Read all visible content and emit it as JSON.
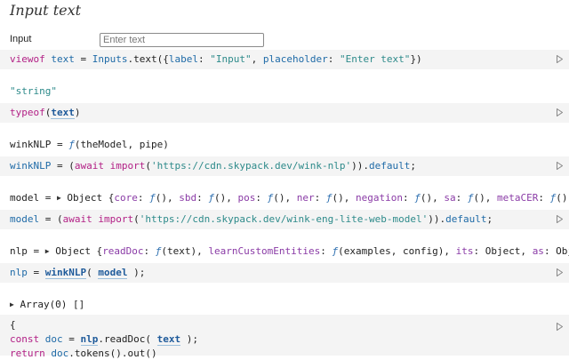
{
  "heading": "Input text",
  "input": {
    "label": "Input",
    "placeholder": "Enter text",
    "value": ""
  },
  "cells": {
    "c1": {
      "t1": "viewof",
      "t2": " text",
      "t3": " = ",
      "t4": "Inputs",
      "t5": ".text({",
      "t6": "label",
      "t7": ": ",
      "t8": "\"Input\"",
      "t9": ", ",
      "t10": "placeholder",
      "t11": ": ",
      "t12": "\"Enter text\"",
      "t13": "})"
    },
    "o2": "\"string\"",
    "c2": {
      "t1": "typeof",
      "t2": "(",
      "t3": "text",
      "t4": ")"
    },
    "o3": {
      "t1": "winkNLP = ",
      "t2": "ƒ",
      "t3": "(theModel, pipe)"
    },
    "c3": {
      "t1": "winkNLP",
      "t2": " = (",
      "t3": "await",
      "t4": " ",
      "t5": "import",
      "t6": "(",
      "t7": "'https://cdn.skypack.dev/wink-nlp'",
      "t8": ")).",
      "t9": "default",
      "t10": ";"
    },
    "o4": {
      "t1": "model = ",
      "t2": "▶",
      "t3": " Object {",
      "k1": "core",
      "v1": ": ",
      "f1": "ƒ",
      "p1": "(), ",
      "k2": "sbd",
      "v2": ": ",
      "f2": "ƒ",
      "p2": "(), ",
      "k3": "pos",
      "v3": ": ",
      "f3": "ƒ",
      "p3": "(), ",
      "k4": "ner",
      "v4": ": ",
      "f4": "ƒ",
      "p4": "(), ",
      "k5": "negation",
      "v5": ": ",
      "f5": "ƒ",
      "p5": "(), ",
      "k6": "sa",
      "v6": ": ",
      "f6": "ƒ",
      "p6": "(), ",
      "k7": "metaCER",
      "v7": ": ",
      "f7": "ƒ",
      "p7": "(),"
    },
    "c4": {
      "t1": "model",
      "t2": " = (",
      "t3": "await",
      "t4": " ",
      "t5": "import",
      "t6": "(",
      "t7": "'https://cdn.skypack.dev/wink-eng-lite-web-model'",
      "t8": ")).",
      "t9": "default",
      "t10": ";"
    },
    "o5": {
      "t1": "nlp = ",
      "t2": "▶",
      "t3": " Object {",
      "k1": "readDoc",
      "v1": ": ",
      "f1": "ƒ",
      "p1": "(text), ",
      "k2": "learnCustomEntities",
      "v2": ": ",
      "f2": "ƒ",
      "p2": "(examples, config), ",
      "k3": "its",
      "v3": ": Object, ",
      "k4": "as",
      "v4": ": Obje"
    },
    "c5": {
      "t1": "nlp",
      "t2": " = ",
      "t3": "winkNLP",
      "t4": "( ",
      "t5": "model",
      "t6": " );"
    },
    "o6": {
      "t1": "▶",
      "t2": " Array(0) []"
    },
    "c6": {
      "l1": "{",
      "l2a": "const",
      "l2b": " doc",
      "l2c": " = ",
      "l2d": "nlp",
      "l2e": ".readDoc( ",
      "l2f": "text",
      "l2g": " );",
      "l3a": "return",
      "l3b": " doc",
      "l3c": ".tokens().out()"
    }
  }
}
